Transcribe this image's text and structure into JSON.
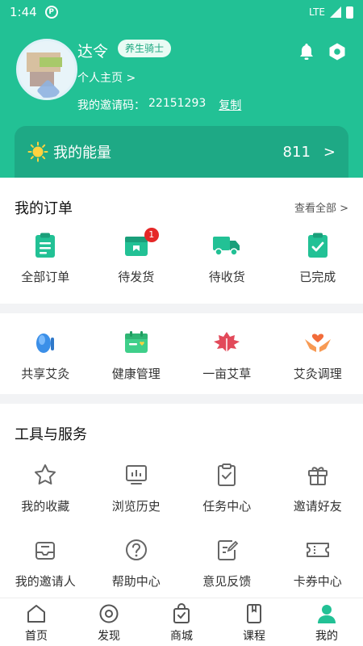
{
  "status_bar": {
    "time": "1:44",
    "network": "LTE"
  },
  "profile": {
    "name": "达令",
    "badge": "养生骑士",
    "homepage_link": "个人主页 >",
    "invite_label": "我的邀请码：",
    "invite_code": "22151293",
    "copy_label": "复制"
  },
  "energy": {
    "label": "我的能量",
    "value": "811",
    "arrow": ">"
  },
  "orders": {
    "title": "我的订单",
    "view_all": "查看全部 >",
    "items": [
      {
        "label": "全部订单",
        "icon": "clipboard-list-icon"
      },
      {
        "label": "待发货",
        "icon": "box-icon",
        "count": "1"
      },
      {
        "label": "待收货",
        "icon": "truck-icon"
      },
      {
        "label": "已完成",
        "icon": "clipboard-check-icon"
      }
    ]
  },
  "services": {
    "items": [
      {
        "label": "共享艾灸",
        "icon": "moxa-icon"
      },
      {
        "label": "健康管理",
        "icon": "calendar-health-icon"
      },
      {
        "label": "一亩艾草",
        "icon": "leaf-icon"
      },
      {
        "label": "艾灸调理",
        "icon": "hands-heart-icon"
      }
    ]
  },
  "tools": {
    "title": "工具与服务",
    "items": [
      {
        "label": "我的收藏",
        "icon": "star-icon"
      },
      {
        "label": "浏览历史",
        "icon": "history-chart-icon"
      },
      {
        "label": "任务中心",
        "icon": "task-clipboard-icon"
      },
      {
        "label": "邀请好友",
        "icon": "gift-icon"
      },
      {
        "label": "我的邀请人",
        "icon": "inbox-icon"
      },
      {
        "label": "帮助中心",
        "icon": "help-icon"
      },
      {
        "label": "意见反馈",
        "icon": "feedback-edit-icon"
      },
      {
        "label": "卡券中心",
        "icon": "ticket-icon"
      }
    ]
  },
  "tab_bar": {
    "active": "我的",
    "tabs": [
      {
        "label": "首页",
        "icon": "home-icon"
      },
      {
        "label": "发现",
        "icon": "discover-icon"
      },
      {
        "label": "商城",
        "icon": "shopping-bag-icon"
      },
      {
        "label": "课程",
        "icon": "course-book-icon"
      },
      {
        "label": "我的",
        "icon": "user-icon"
      }
    ]
  },
  "colors": {
    "brand": "#22c195",
    "energy_bg": "#1ea985",
    "badge_red": "#e52727",
    "icon_green": "#22c195"
  }
}
